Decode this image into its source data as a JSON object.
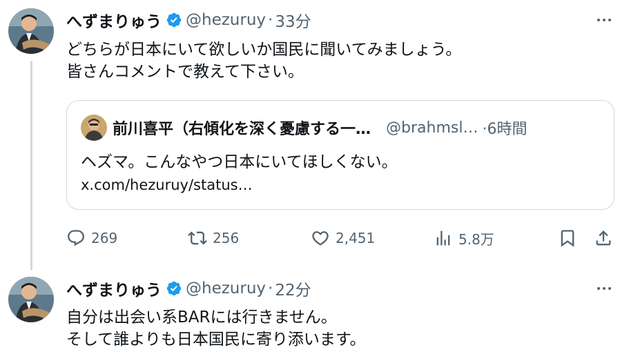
{
  "tweets": [
    {
      "author_name": "へずまりゅう",
      "handle": "@hezuruy",
      "dot": "·",
      "time": "33分",
      "lines": [
        "どちらが日本にいて欲しいか国民に聞いてみましょう。",
        "皆さんコメントで教えて下さい。"
      ],
      "quote": {
        "author_name": "前川喜平（右傾化を深く憂慮する一…",
        "handle": "@brahmsl…",
        "time": "·6時間",
        "text": "ヘズマ。こんなやつ日本にいてほしくない。",
        "link": "x.com/hezuruy/status…"
      },
      "stats": {
        "replies": "269",
        "retweets": "256",
        "likes": "2,451",
        "views": "5.8万"
      }
    },
    {
      "author_name": "へずまりゅう",
      "handle": "@hezuruy",
      "dot": "·",
      "time": "22分",
      "lines": [
        "自分は出会い系BARには行きません。",
        "そして誰よりも日本国民に寄り添います。"
      ]
    }
  ],
  "icons": {
    "verified": "verified-badge-icon",
    "more": "more-icon",
    "reply": "reply-icon",
    "retweet": "retweet-icon",
    "like": "like-icon",
    "views": "views-icon",
    "bookmark": "bookmark-icon",
    "share": "share-icon"
  },
  "colors": {
    "verified": "#1d9bf0",
    "secondary_text": "#536471",
    "border": "#cfd9de"
  }
}
